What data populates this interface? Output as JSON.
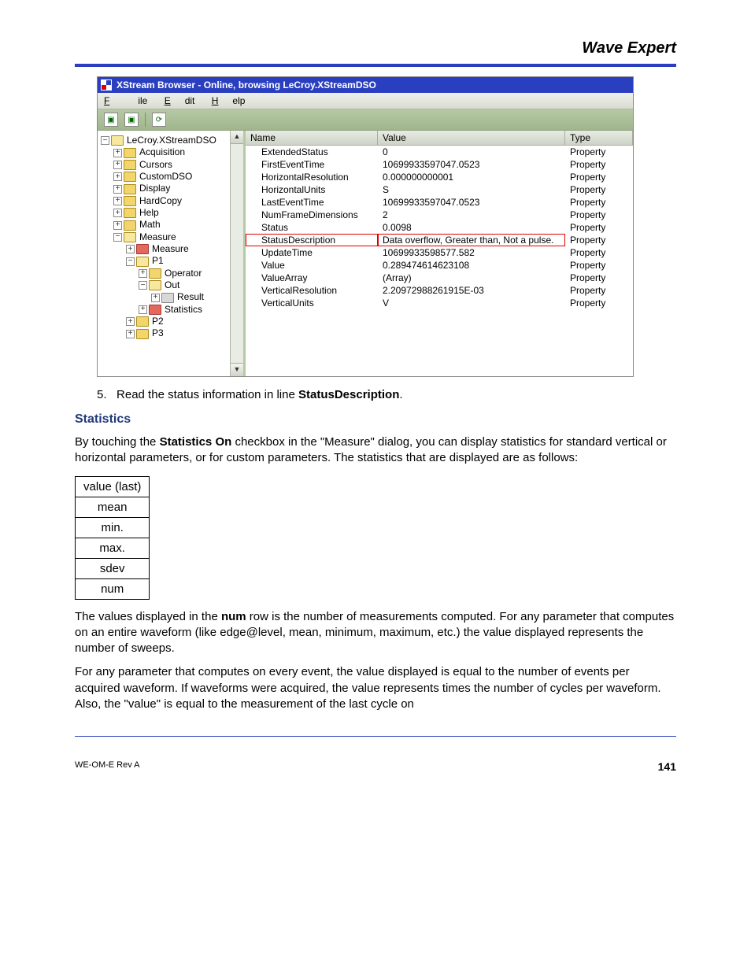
{
  "doc": {
    "title": "Wave Expert",
    "footer_left": "WE-OM-E Rev A",
    "footer_page": "141"
  },
  "window": {
    "title": "XStream Browser - Online, browsing LeCroy.XStreamDSO",
    "menu": {
      "file": "File",
      "edit": "Edit",
      "help": "Help"
    }
  },
  "columns": {
    "name": "Name",
    "value": "Value",
    "type": "Type"
  },
  "tree": {
    "root": "LeCroy.XStreamDSO",
    "items": [
      "Acquisition",
      "Cursors",
      "CustomDSO",
      "Display",
      "HardCopy",
      "Help",
      "Math"
    ],
    "measure": "Measure",
    "measure_sub": "Measure",
    "p1": "P1",
    "operator": "Operator",
    "out": "Out",
    "result": "Result",
    "statistics": "Statistics",
    "p2": "P2",
    "p3": "P3"
  },
  "props": [
    {
      "n": "ExtendedStatus",
      "v": "0",
      "t": "Property"
    },
    {
      "n": "FirstEventTime",
      "v": "10699933597047.0523",
      "t": "Property"
    },
    {
      "n": "HorizontalResolution",
      "v": "0.000000000001",
      "t": "Property"
    },
    {
      "n": "HorizontalUnits",
      "v": "S",
      "t": "Property"
    },
    {
      "n": "LastEventTime",
      "v": "10699933597047.0523",
      "t": "Property"
    },
    {
      "n": "NumFrameDimensions",
      "v": "2",
      "t": "Property"
    },
    {
      "n": "Status",
      "v": "0.0098",
      "t": "Property"
    },
    {
      "n": "StatusDescription",
      "v": "Data overflow, Greater than, Not a pulse.",
      "t": "Property",
      "red": true
    },
    {
      "n": "UpdateTime",
      "v": "10699933598577.582",
      "t": "Property"
    },
    {
      "n": "Value",
      "v": "0.289474614623108",
      "t": "Property"
    },
    {
      "n": "ValueArray",
      "v": "(Array)",
      "t": "Property"
    },
    {
      "n": "VerticalResolution",
      "v": "2.20972988261915E-03",
      "t": "Property"
    },
    {
      "n": "VerticalUnits",
      "v": "V",
      "t": "Property"
    }
  ],
  "text": {
    "step_num": "5.",
    "step_a": "Read the status information in line ",
    "step_b": "StatusDescription",
    "step_c": ".",
    "section": "Statistics",
    "p1a": "By touching the ",
    "p1b": "Statistics On",
    "p1c": " checkbox in the \"Measure\" dialog, you can display statistics for standard vertical or horizontal parameters, or for custom parameters. The statistics that are displayed are as follows:",
    "stats": [
      "value (last)",
      "mean",
      "min.",
      "max.",
      "sdev",
      "num"
    ],
    "p2a": "The values displayed in the ",
    "p2b": "num",
    "p2c": " row is the number of measurements computed. For any parameter that computes on an entire waveform (like edge@level, mean, minimum, maximum, etc.) the value displayed represents the number of sweeps.",
    "p3": "For any parameter that computes on every event, the value displayed is equal to the number of events per acquired waveform. If    waveforms were acquired, the value represents    times the number of cycles per waveform. Also, the \"value\" is equal to the measurement of the last cycle on"
  }
}
